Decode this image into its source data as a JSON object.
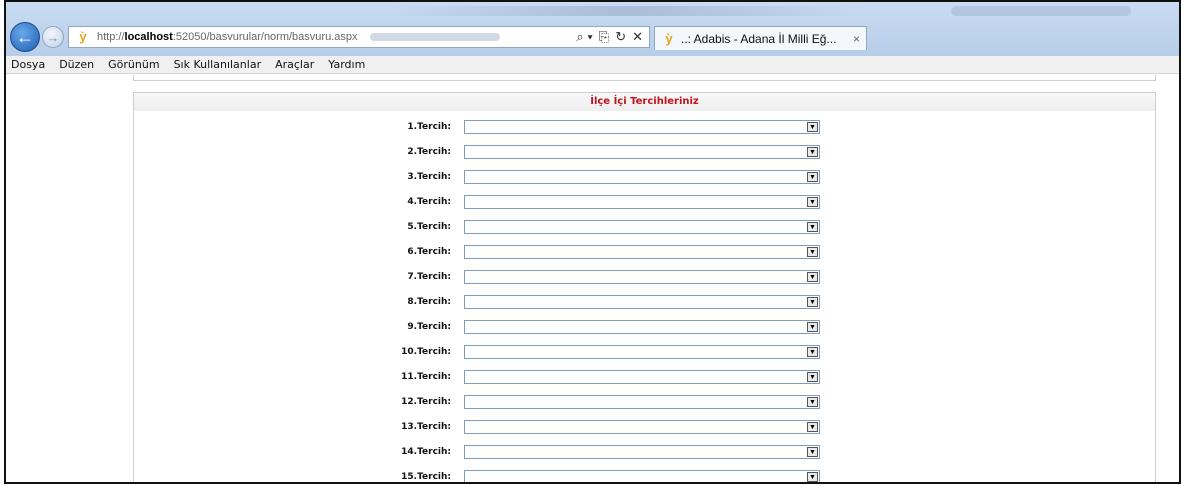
{
  "browser": {
    "address": {
      "prefix": "http://",
      "host": "localhost",
      "path": ":52050/basvurular/norm/basvuru.aspx",
      "tools": [
        "⌕ ▾",
        "⎘",
        "↻",
        "✕"
      ]
    },
    "tab": {
      "title": "..: Adabis - Adana İl Milli Eğ...",
      "close": "×"
    }
  },
  "menu": {
    "items": [
      "Dosya",
      "Düzen",
      "Görünüm",
      "Sık Kullanılanlar",
      "Araçlar",
      "Yardım"
    ]
  },
  "form": {
    "title": "İlçe İçi Tercihleriniz",
    "rows": [
      {
        "label": "1.Tercih:",
        "value": ""
      },
      {
        "label": "2.Tercih:",
        "value": ""
      },
      {
        "label": "3.Tercih:",
        "value": ""
      },
      {
        "label": "4.Tercih:",
        "value": ""
      },
      {
        "label": "5.Tercih:",
        "value": ""
      },
      {
        "label": "6.Tercih:",
        "value": ""
      },
      {
        "label": "7.Tercih:",
        "value": ""
      },
      {
        "label": "8.Tercih:",
        "value": ""
      },
      {
        "label": "9.Tercih:",
        "value": ""
      },
      {
        "label": "10.Tercih:",
        "value": ""
      },
      {
        "label": "11.Tercih:",
        "value": ""
      },
      {
        "label": "12.Tercih:",
        "value": ""
      },
      {
        "label": "13.Tercih:",
        "value": ""
      },
      {
        "label": "14.Tercih:",
        "value": ""
      },
      {
        "label": "15.Tercih:",
        "value": ""
      }
    ]
  },
  "colors": {
    "title_accent": "#c1121f",
    "select_border": "#7f9db9",
    "menubar_bg": "#f0f0f0"
  },
  "icons": {
    "back": "back-arrow-icon",
    "forward": "forward-arrow-icon",
    "site": "site-favicon-icon",
    "dropdown": "chevron-down-icon"
  }
}
